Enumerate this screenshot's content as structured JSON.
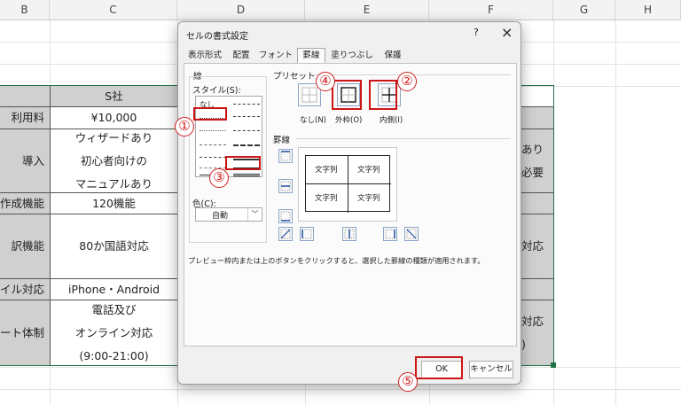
{
  "columns": [
    "B",
    "C",
    "D",
    "E",
    "F",
    "G",
    "H"
  ],
  "sheet": {
    "header_c": "S社",
    "rows": [
      {
        "b": "利用料",
        "c": [
          "¥10,000"
        ]
      },
      {
        "b": "導入",
        "c": [
          "ウィザードあり",
          "初心者向けの",
          "マニュアルあり"
        ],
        "f": [
          "あり",
          "必要"
        ]
      },
      {
        "b": "作成機能",
        "c": [
          "120機能"
        ]
      },
      {
        "b": "訳機能",
        "c": [
          "80か国語対応"
        ],
        "f": [
          "対応"
        ]
      },
      {
        "b": "イル対応",
        "c": [
          "iPhone・Android"
        ]
      },
      {
        "b": "ート体制",
        "c": [
          "電話及び",
          "オンライン対応",
          "(9:00-21:00)"
        ],
        "f": [
          "対応",
          ")"
        ]
      }
    ]
  },
  "dialog": {
    "title": "セルの書式設定",
    "help": "?",
    "close": "×",
    "tabs": [
      "表示形式",
      "配置",
      "フォント",
      "罫線",
      "塗りつぶし",
      "保護"
    ],
    "active_tab": "罫線",
    "line_group": "線",
    "style_label": "スタイル(S):",
    "style_none": "なし",
    "color_label": "色(C):",
    "color_value": "自動",
    "preset_label": "プリセット",
    "presets": [
      "なし(N)",
      "外枠(O)",
      "内側(I)"
    ],
    "border_label": "罫線",
    "preview_text": [
      "文字列",
      "文字列",
      "文字列",
      "文字列"
    ],
    "hint": "プレビュー枠内または上のボタンをクリックすると、選択した罫線の種類が適用されます。",
    "ok": "OK",
    "cancel": "キャンセル"
  },
  "annotations": [
    "①",
    "②",
    "③",
    "④",
    "⑤"
  ],
  "colors": {
    "highlight": "#cc1414",
    "selection_border": "#217346",
    "gray_cell": "#d0d0d0"
  }
}
